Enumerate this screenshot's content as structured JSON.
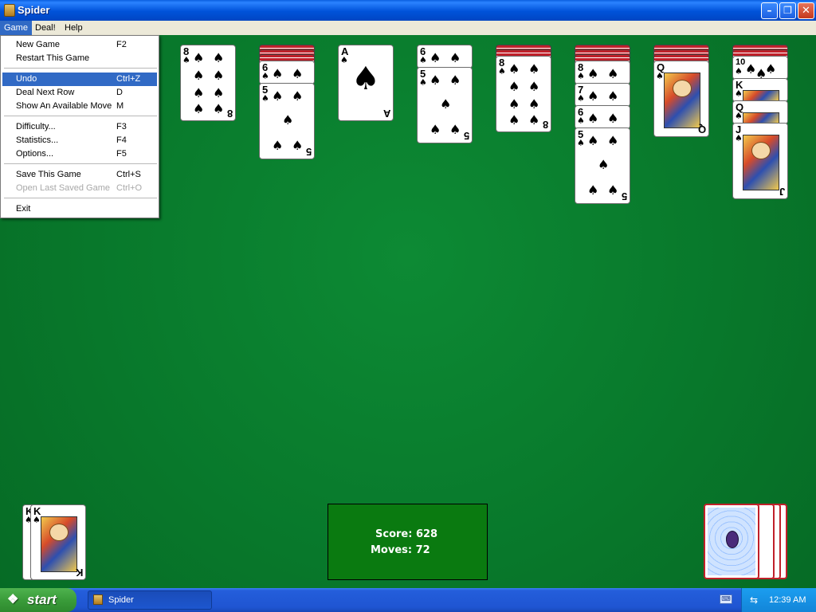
{
  "window": {
    "title": "Spider"
  },
  "title_buttons": {
    "minimize": "–",
    "maximize": "❐",
    "close": "✕"
  },
  "menubar": {
    "game": "Game",
    "deal": "Deal!",
    "help": "Help"
  },
  "game_menu": {
    "items": [
      {
        "label": "New Game",
        "shortcut": "F2"
      },
      {
        "label": "Restart This Game",
        "shortcut": ""
      },
      {
        "label": "Undo",
        "shortcut": "Ctrl+Z"
      },
      {
        "label": "Deal Next Row",
        "shortcut": "D"
      },
      {
        "label": "Show An Available Move",
        "shortcut": "M"
      },
      {
        "label": "Difficulty...",
        "shortcut": "F3"
      },
      {
        "label": "Statistics...",
        "shortcut": "F4"
      },
      {
        "label": "Options...",
        "shortcut": "F5"
      },
      {
        "label": "Save This Game",
        "shortcut": "Ctrl+S"
      },
      {
        "label": "Open Last Saved Game",
        "shortcut": "Ctrl+O"
      },
      {
        "label": "Exit",
        "shortcut": ""
      }
    ],
    "highlighted": "Undo",
    "disabled": "Open Last Saved Game"
  },
  "suit_glyph": "♠",
  "tableau": {
    "col1": {
      "ranks": [
        "8"
      ]
    },
    "col2": {
      "ranks": [
        "6",
        "5"
      ]
    },
    "col3": {
      "ranks": [
        "A"
      ]
    },
    "col4": {
      "ranks": [
        "6",
        "5"
      ]
    },
    "col5": {
      "ranks": [
        "8"
      ]
    },
    "col6": {
      "ranks": [
        "8",
        "7",
        "6",
        "5"
      ]
    },
    "col7": {
      "ranks": [
        "Q"
      ]
    },
    "col8": {
      "ranks": [
        "10",
        "K",
        "Q",
        "J"
      ]
    }
  },
  "completed": {
    "ranks": [
      "K",
      "K"
    ]
  },
  "status": {
    "score_label": "Score:",
    "score": "628",
    "moves_label": "Moves:",
    "moves": "72"
  },
  "taskbar": {
    "start": "start",
    "task": "Spider",
    "clock": "12:39 AM"
  },
  "colors": {
    "felt": "#0a7a2a",
    "card_back": "#c0202a",
    "highlight": "#316ac5",
    "score_box": "#0a7a10"
  }
}
